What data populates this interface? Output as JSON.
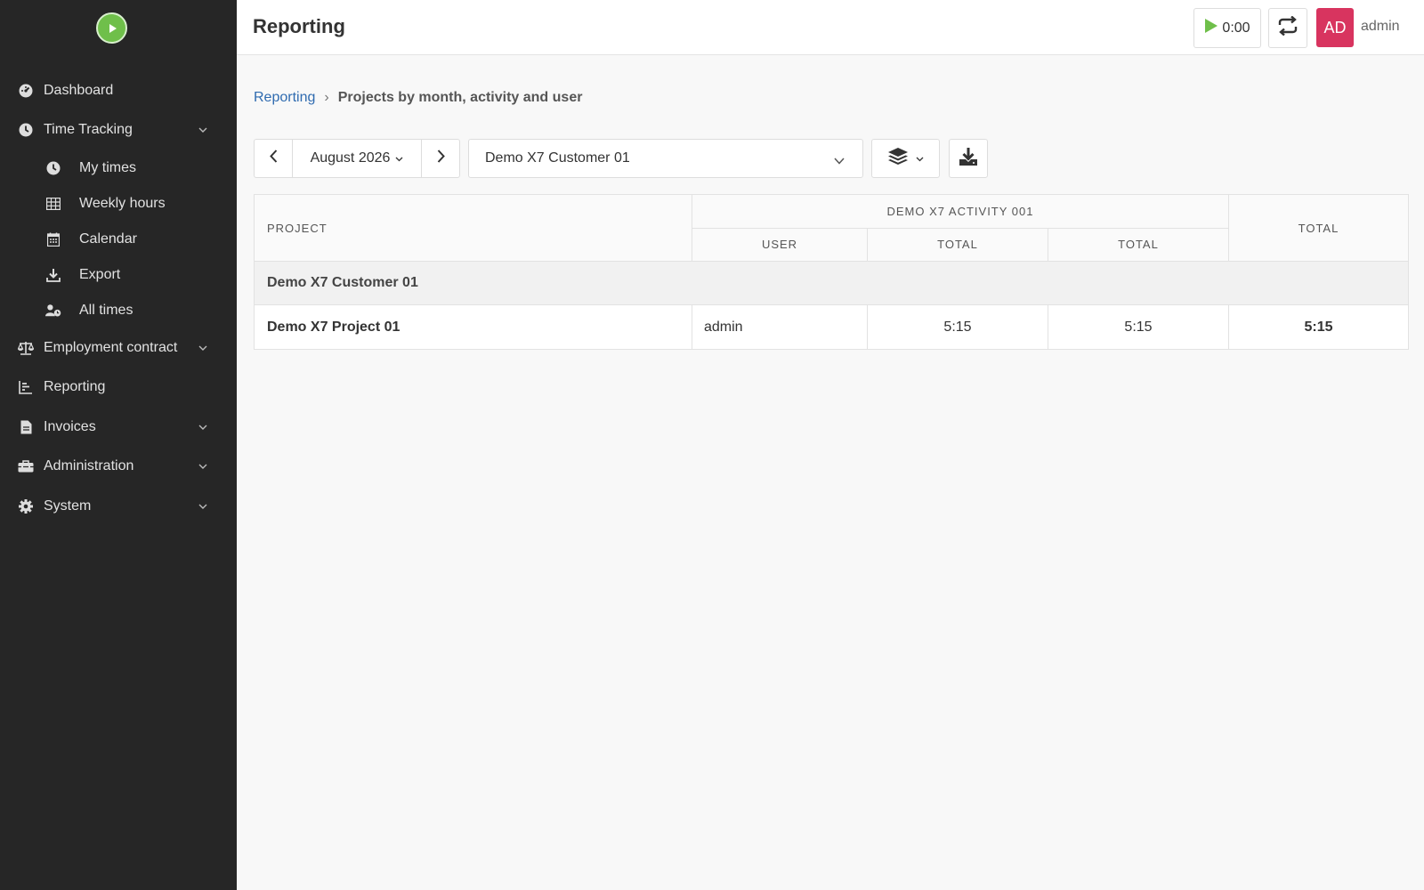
{
  "app": {
    "logo_icon": "play-logo-icon",
    "brand_color": "#6fbf4a"
  },
  "sidebar": {
    "items": [
      {
        "label": "Dashboard",
        "icon": "dashboard-icon"
      },
      {
        "label": "Time Tracking",
        "icon": "clock-icon",
        "expanded": true
      },
      {
        "label": "My times",
        "icon": "clock-icon"
      },
      {
        "label": "Weekly hours",
        "icon": "grid-icon"
      },
      {
        "label": "Calendar",
        "icon": "calendar-icon"
      },
      {
        "label": "Export",
        "icon": "download-icon"
      },
      {
        "label": "All times",
        "icon": "user-clock-icon"
      },
      {
        "label": "Employment contract",
        "icon": "scale-icon"
      },
      {
        "label": "Reporting",
        "icon": "chart-icon"
      },
      {
        "label": "Invoices",
        "icon": "invoice-icon"
      },
      {
        "label": "Administration",
        "icon": "toolbox-icon"
      },
      {
        "label": "System",
        "icon": "gear-icon"
      }
    ]
  },
  "header": {
    "title": "Reporting",
    "timer": "0:00",
    "avatar_initials": "AD",
    "avatar_color": "#d8345f",
    "username": "admin"
  },
  "breadcrumb": {
    "parent": "Reporting",
    "separator": "›",
    "current": "Projects by month, activity and user"
  },
  "toolbar": {
    "month": "August 2026",
    "customer": "Demo X7 Customer 01"
  },
  "table": {
    "header": {
      "project": "PROJECT",
      "activity": "DEMO X7 ACTIVITY 001",
      "user": "USER",
      "activity_total": "TOTAL",
      "user_total": "TOTAL",
      "total": "TOTAL"
    },
    "group": "Demo X7 Customer 01",
    "rows": [
      {
        "project": "Demo X7 Project 01",
        "user": "admin",
        "activity_total": "5:15",
        "user_total": "5:15",
        "total": "5:15"
      }
    ]
  }
}
